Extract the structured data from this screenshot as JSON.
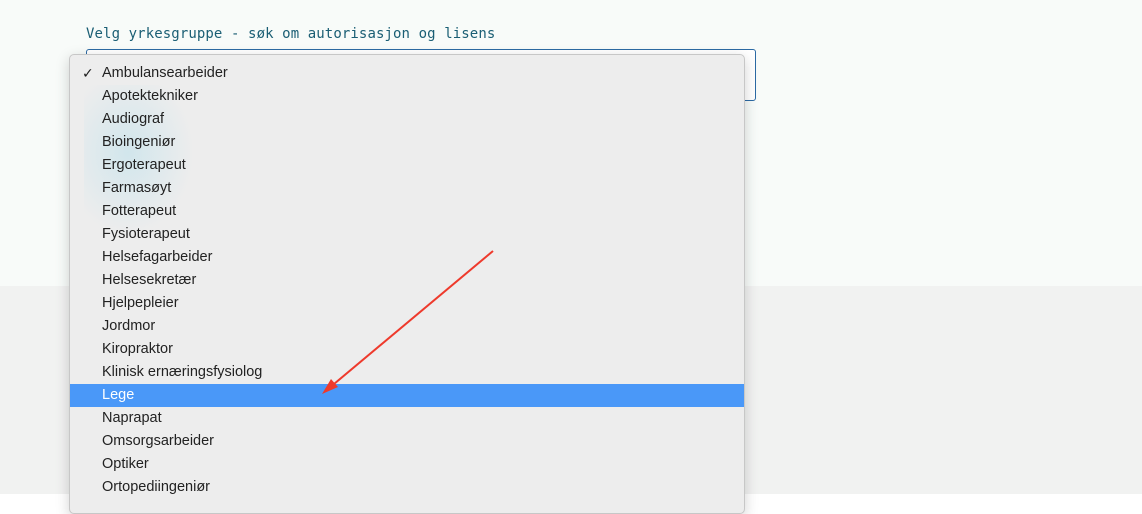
{
  "form": {
    "label": "Velg yrkesgruppe - søk om autorisasjon og lisens"
  },
  "dropdown": {
    "selected_index": 0,
    "highlighted_index": 14,
    "options": [
      "Ambulansearbeider",
      "Apotektekniker",
      "Audiograf",
      "Bioingeniør",
      "Ergoterapeut",
      "Farmasøyt",
      "Fotterapeut",
      "Fysioterapeut",
      "Helsefagarbeider",
      "Helsesekretær",
      "Hjelpepleier",
      "Jordmor",
      "Kiropraktor",
      "Klinisk ernæringsfysiolog",
      "Lege",
      "Naprapat",
      "Omsorgsarbeider",
      "Optiker",
      "Ortopediingeniør"
    ],
    "check_icon": "✓"
  },
  "colors": {
    "label_text": "#1a5e74",
    "select_border": "#2c6aa4",
    "highlight": "#4a98f8",
    "annotation_arrow": "#ee3a2c"
  }
}
